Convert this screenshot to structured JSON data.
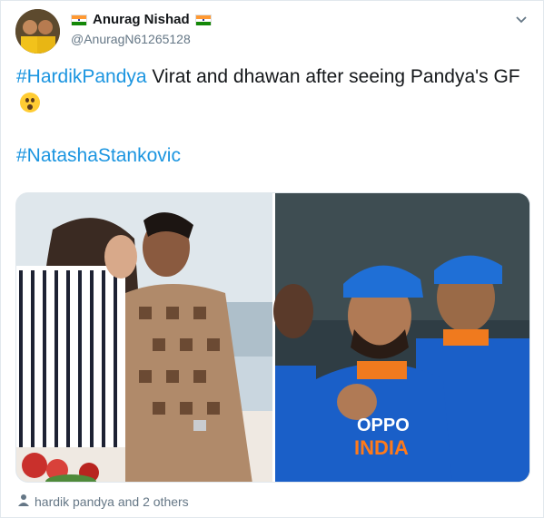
{
  "author": {
    "display_name": "Anurag Nishad",
    "handle": "@AnuragN61265128",
    "avatar_icon": "avatar",
    "flag_icon": "india-flag-icon"
  },
  "tweet": {
    "hashtag1": "#HardikPandya",
    "text": " Virat and dhawan after seeing Pandya's GF",
    "emoji_icon": "astonished-face-emoji",
    "hashtag2": "#NatashaStankovic"
  },
  "media": {
    "left_image_desc": "couple-photo",
    "right_image_desc": "cricketers-photo",
    "jersey_text": "OPPO",
    "jersey_country": "INDIA"
  },
  "footer": {
    "tagged_text": "hardik pandya and 2 others"
  },
  "colors": {
    "link": "#1b95e0",
    "secondary_text": "#657786",
    "jersey_blue": "#1a5fc8"
  }
}
